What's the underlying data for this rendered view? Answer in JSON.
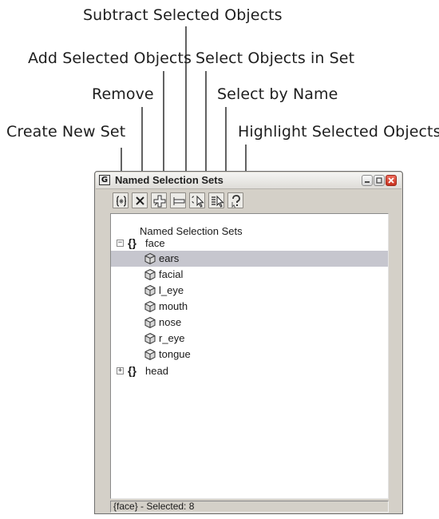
{
  "callouts": {
    "subtract": "Subtract Selected Objects",
    "add": "Add Selected Objects",
    "select_in_set": "Select Objects in Set",
    "remove": "Remove",
    "select_by_name": "Select by Name",
    "create_new_set": "Create New Set",
    "highlight": "Highlight Selected Objects"
  },
  "window": {
    "app_icon": "G",
    "title": "Named Selection Sets",
    "controls": [
      "minimize-icon",
      "maximize-icon",
      "close-icon"
    ]
  },
  "toolbar": {
    "buttons": [
      {
        "name": "create-new-set",
        "icon": "braces-star-icon"
      },
      {
        "name": "remove",
        "icon": "x-icon"
      },
      {
        "name": "add-selected-objects",
        "icon": "plus-icon"
      },
      {
        "name": "subtract-selected-objects",
        "icon": "minus-icon"
      },
      {
        "name": "select-objects-in-set",
        "icon": "cursor-icon"
      },
      {
        "name": "select-by-name",
        "icon": "list-cursor-icon"
      },
      {
        "name": "highlight-selected-objects",
        "icon": "question-icon"
      }
    ]
  },
  "tree": {
    "header": "Named Selection Sets",
    "sets": [
      {
        "brace": "{}",
        "label": "face",
        "expander": "−",
        "objects": [
          "ears",
          "facial",
          "l_eye",
          "mouth",
          "nose",
          "r_eye",
          "tongue"
        ],
        "selected": "ears"
      },
      {
        "brace": "{}",
        "label": "head",
        "expander": "+"
      }
    ]
  },
  "status": "{face} - Selected: 8",
  "colors": {
    "panel": "#d4d0c8",
    "selection": "#c6c6ce",
    "close_button": "#d64533"
  }
}
